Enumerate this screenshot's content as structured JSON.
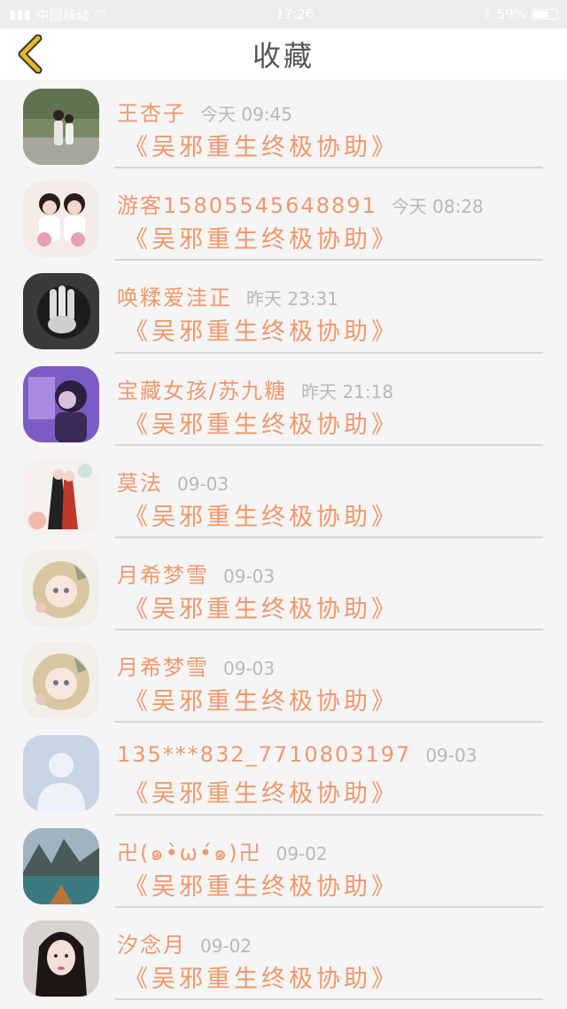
{
  "status_bar": {
    "carrier": "中国移动",
    "time": "17:26",
    "battery": "59%"
  },
  "header": {
    "title": "收藏",
    "accent_color": "#e8b820"
  },
  "items": [
    {
      "name": "王杏子",
      "time": "今天 09:45",
      "book": "《吴邪重生终极协助》",
      "avatar": "photo-couple"
    },
    {
      "name": "游客15805545648891",
      "time": "今天 08:28",
      "book": "《吴邪重生终极协助》",
      "avatar": "photo-two-girls"
    },
    {
      "name": "唤糅爱洼正",
      "time": "昨天 23:31",
      "book": "《吴邪重生终极协助》",
      "avatar": "photo-hand-bw"
    },
    {
      "name": "宝藏女孩/苏九糖",
      "time": "昨天 21:18",
      "book": "《吴邪重生终极协助》",
      "avatar": "photo-purple-girl"
    },
    {
      "name": "莫法",
      "time": "09-03",
      "book": "《吴邪重生终极协助》",
      "avatar": "illustration-couple"
    },
    {
      "name": "月希梦雪",
      "time": "09-03",
      "book": "《吴邪重生终极协助》",
      "avatar": "illustration-girl"
    },
    {
      "name": "月希梦雪",
      "time": "09-03",
      "book": "《吴邪重生终极协助》",
      "avatar": "illustration-girl"
    },
    {
      "name": "135***832_7710803197",
      "time": "09-03",
      "book": "《吴邪重生终极协助》",
      "avatar": "default-user"
    },
    {
      "name": "卍(๑•̀ω•́๑)卍",
      "time": "09-02",
      "book": "《吴邪重生终极协助》",
      "avatar": "photo-lake-mountains"
    },
    {
      "name": "汐念月",
      "time": "09-02",
      "book": "《吴邪重生终极协助》",
      "avatar": "photo-girl-portrait"
    }
  ]
}
